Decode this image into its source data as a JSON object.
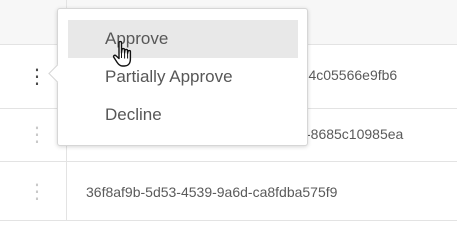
{
  "table": {
    "rows": [
      {
        "id": ""
      },
      {
        "id": "2-4c05566e9fb6"
      },
      {
        "id": "-8685c10985ea"
      },
      {
        "id": "36f8af9b-5d53-4539-9a6d-ca8fdba575f9"
      }
    ],
    "kebab_glyph": "⋮"
  },
  "menu": {
    "items": [
      {
        "label": "Approve"
      },
      {
        "label": "Partially Approve"
      },
      {
        "label": "Decline"
      }
    ]
  },
  "icons": [
    "kebab-menu-icon",
    "hand-pointer-cursor-icon"
  ],
  "colors": {
    "header_bg": "#f7f7f7",
    "border": "#e3e3e3",
    "hover_bg": "#e8e8e8",
    "text": "#575757"
  }
}
